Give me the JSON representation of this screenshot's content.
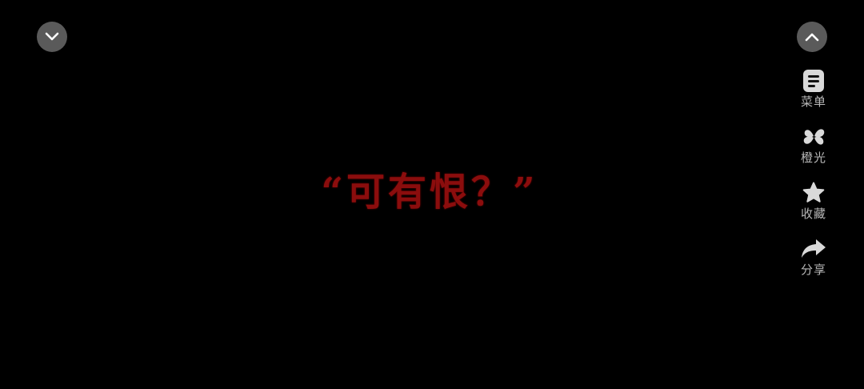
{
  "top_controls": {
    "collapse_icon": "chevron-down-icon",
    "expand_icon": "chevron-up-icon"
  },
  "side_menu": {
    "items": [
      {
        "label": "菜单",
        "icon": "menu-icon"
      },
      {
        "label": "橙光",
        "icon": "orange-light-icon"
      },
      {
        "label": "收藏",
        "icon": "star-icon"
      },
      {
        "label": "分享",
        "icon": "share-icon"
      }
    ]
  },
  "scene": {
    "quote_text": "“可有恨？”",
    "quote_color": "#8b0d0d"
  },
  "colors": {
    "background": "#000000",
    "button_bg": "#5a5a5a",
    "icon_color": "#d9d9d9",
    "label_color": "#b8b8b8"
  }
}
